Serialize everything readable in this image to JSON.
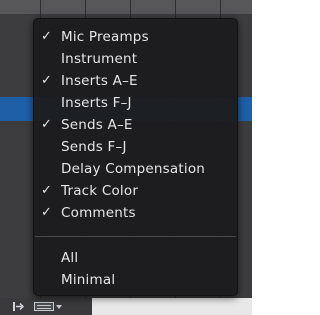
{
  "menu": {
    "items": [
      {
        "label": "Mic Preamps",
        "checked": true
      },
      {
        "label": "Instrument",
        "checked": false
      },
      {
        "label": "Inserts A–E",
        "checked": true
      },
      {
        "label": "Inserts F–J",
        "checked": false
      },
      {
        "label": "Sends A–E",
        "checked": true
      },
      {
        "label": "Sends F–J",
        "checked": false
      },
      {
        "label": "Delay Compensation",
        "checked": false
      },
      {
        "label": "Track Color",
        "checked": true
      },
      {
        "label": "Comments",
        "checked": true
      }
    ],
    "presets": [
      {
        "label": "All"
      },
      {
        "label": "Minimal"
      }
    ],
    "check_glyph": "✓"
  },
  "bottom_bar": {
    "toggle_icon": "toggle-sidebar-icon",
    "view_icon": "mixer-view-selector-icon"
  },
  "colors": {
    "menu_bg": "#1c1c1e",
    "menu_text": "#e6e6e6",
    "selection_band": "#1e5fa8"
  }
}
